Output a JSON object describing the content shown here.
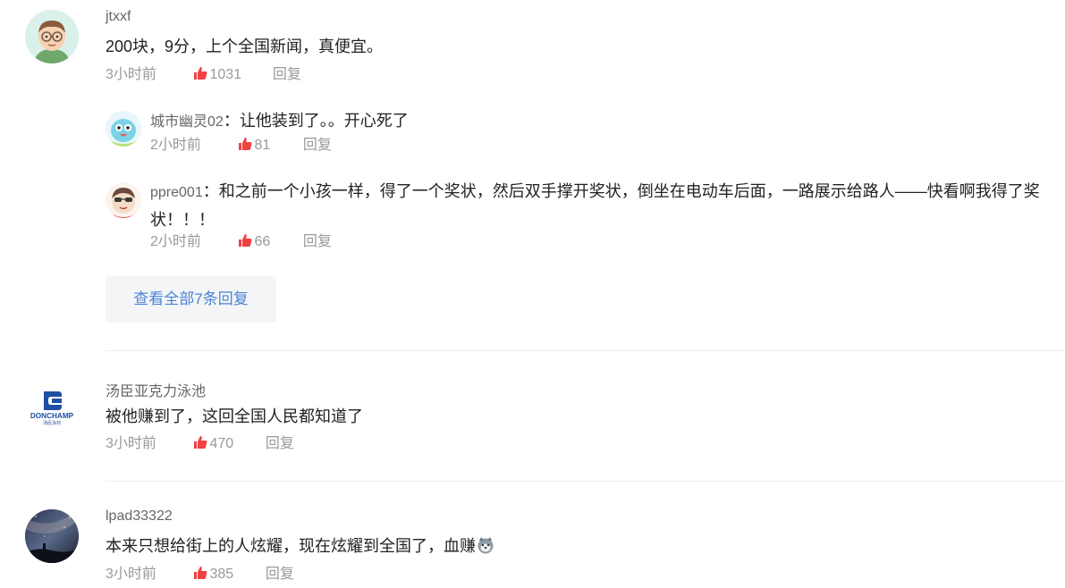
{
  "comments": [
    {
      "user": "jtxxf",
      "text": "200块，9分，上个全国新闻，真便宜。",
      "time": "3小时前",
      "likes": "1031",
      "reply_label": "回复",
      "avatar_icon": "cartoon-glasses-boy-avatar",
      "replies": [
        {
          "user": "城市幽灵02",
          "separator": "：",
          "text": "让他装到了。。开心死了",
          "time": "2小时前",
          "likes": "81",
          "reply_label": "回复",
          "avatar_icon": "cartoon-blue-bird-avatar"
        },
        {
          "user": "ppre001",
          "separator": "：",
          "text": "和之前一个小孩一样，得了一个奖状，然后双手撑开奖状，倒坐在电动车后面，一路展示给路人——快看啊我得了奖状！！！",
          "time": "2小时前",
          "likes": "66",
          "reply_label": "回复",
          "avatar_icon": "cartoon-sunglasses-avatar"
        }
      ],
      "view_all_label": "查看全部7条回复"
    },
    {
      "user": "汤臣亚克力泳池",
      "text": "被他赚到了，这回全国人民都知道了",
      "time": "3小时前",
      "likes": "470",
      "reply_label": "回复",
      "avatar_icon": "donchamp-logo-avatar",
      "logo_text": "DONCHAMP",
      "logo_sub": "汤臣泳材"
    },
    {
      "user": "lpad33322",
      "text": "本来只想给街上的人炫耀，现在炫耀到全国了，血赚",
      "time": "3小时前",
      "likes": "385",
      "reply_label": "回复",
      "avatar_icon": "night-sky-photo-avatar",
      "trailing_emoji": "husky-emoji"
    }
  ],
  "colors": {
    "like_icon": "#f04142",
    "link": "#4a83d6",
    "meta": "#999999",
    "divider": "#ececec"
  }
}
